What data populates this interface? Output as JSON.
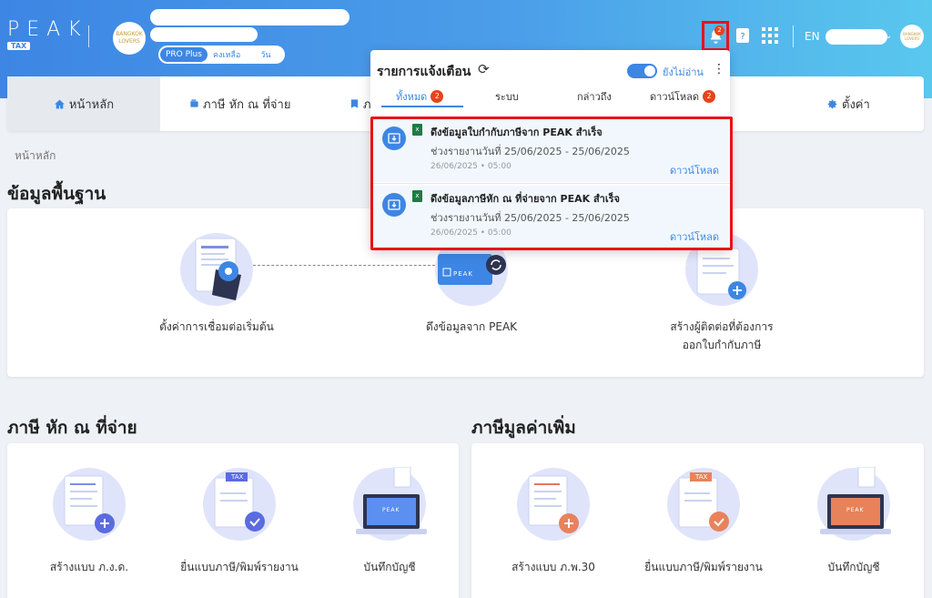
{
  "header": {
    "logo_text": "PEAK",
    "logo_sub": "TAX",
    "company_logo_text": "BANGKOK LOVERS",
    "plan": {
      "badge": "PRO Plus",
      "remaining_label": "คงเหลือ",
      "days_label": "วัน"
    },
    "bell_badge": "2",
    "language": "EN",
    "avatar_text": "BANGKOK LOVERS"
  },
  "nav": {
    "items": [
      {
        "label": "หน้าหลัก",
        "icon": "home-icon"
      },
      {
        "label": "ภาษี หัก ณ ที่จ่าย",
        "icon": "wallet-icon"
      },
      {
        "label": "ภ",
        "icon": "tag-icon"
      },
      {
        "label": "ตั้งค่า",
        "icon": "gear-icon"
      }
    ]
  },
  "breadcrumb": "หน้าหลัก",
  "basic_info": {
    "title": "ข้อมูลพื้นฐาน",
    "features": [
      {
        "label": "ตั้งค่าการเชื่อมต่อเริ่มต้น"
      },
      {
        "label": "ดึงข้อมูลจาก PEAK",
        "badge_text": "PEAK"
      },
      {
        "label_line1": "สร้างผู้ติดต่อที่ต้องการ",
        "label_line2": "ออกใบกำกับภาษี"
      }
    ]
  },
  "wht": {
    "title": "ภาษี หัก ณ ที่จ่าย",
    "features": [
      {
        "label": "สร้างแบบ ภ.ง.ด."
      },
      {
        "label": "ยื่นแบบภาษี/พิมพ์รายงาน",
        "tax_text": "TAX"
      },
      {
        "label": "บันทึกบัญชี",
        "peak_text": "PEAK"
      }
    ]
  },
  "vat": {
    "title": "ภาษีมูลค่าเพิ่ม",
    "features": [
      {
        "label": "สร้างแบบ ภ.พ.30"
      },
      {
        "label": "ยื่นแบบภาษี/พิมพ์รายงาน",
        "tax_text": "TAX"
      },
      {
        "label": "บันทึกบัญชี",
        "peak_text": "PEAK"
      }
    ]
  },
  "notifications": {
    "title": "รายการแจ้งเตือน",
    "unread_only_label": "ยังไม่อ่าน",
    "tabs": [
      {
        "label": "ทั้งหมด",
        "badge": "2"
      },
      {
        "label": "ระบบ"
      },
      {
        "label": "กล่าวถึง"
      },
      {
        "label": "ดาวน์โหลด",
        "badge": "2"
      }
    ],
    "items": [
      {
        "title": "ดึงข้อมูลใบกำกับภาษีจาก PEAK สำเร็จ",
        "description": "ช่วงรายงานวันที่ 25/06/2025 - 25/06/2025",
        "time": "26/06/2025 • 05:00",
        "action": "ดาวน์โหลด"
      },
      {
        "title": "ดึงข้อมูลภาษีหัก ณ ที่จ่ายจาก PEAK สำเร็จ",
        "description": "ช่วงรายงานวันที่ 25/06/2025 - 25/06/2025",
        "time": "26/06/2025 • 05:00",
        "action": "ดาวน์โหลด"
      }
    ]
  }
}
